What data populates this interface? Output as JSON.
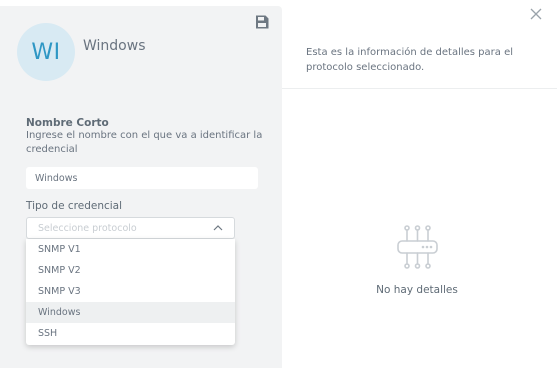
{
  "profile": {
    "initials": "WI",
    "name": "Windows"
  },
  "toolbar": {
    "save_icon": "save-icon"
  },
  "form": {
    "short_name_label": "Nombre Corto",
    "short_name_help": "Ingrese el nombre con el que va a identificar la credencial",
    "short_name_value": "Windows",
    "credential_type_label": "Tipo de credencial",
    "credential_type_placeholder": "Seleccione protocolo",
    "credential_type_options": [
      "SNMP V1",
      "SNMP V2",
      "SNMP V3",
      "Windows",
      "SSH"
    ],
    "hovered_option": "Windows"
  },
  "details": {
    "intro": "Esta es la información de detalles para el protocolo seleccionado.",
    "empty_message": "No hay detalles",
    "empty_icon": "network-device-icon"
  },
  "colors": {
    "accent": "#2e97c4",
    "avatar_bg": "#d8eaf3",
    "panel_bg": "#f2f3f4"
  }
}
